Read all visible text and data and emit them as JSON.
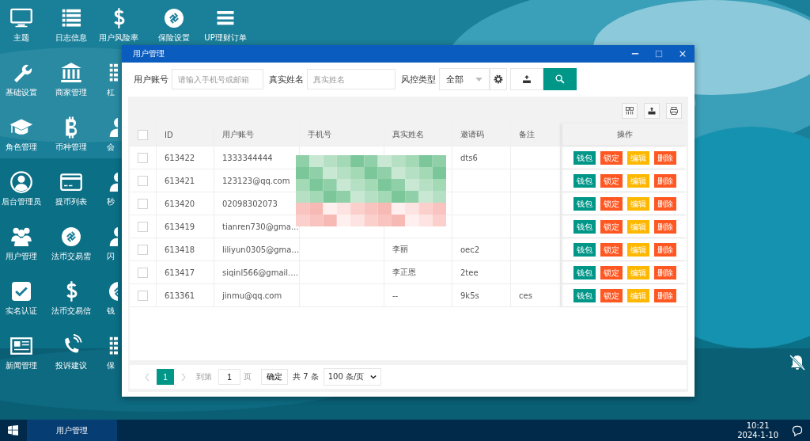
{
  "desktop_columns": [
    [
      {
        "kind": "monitor",
        "label": "主题"
      },
      {
        "kind": "wrench",
        "label": "基础设置"
      },
      {
        "kind": "grad",
        "label": "角色管理"
      },
      {
        "kind": "avatar",
        "label": "后台管理员"
      },
      {
        "kind": "users",
        "label": "用户管理"
      },
      {
        "kind": "check",
        "label": "实名认证"
      },
      {
        "kind": "news",
        "label": "新闻管理"
      }
    ],
    [
      {
        "kind": "list",
        "label": "日志信息"
      },
      {
        "kind": "bank",
        "label": "商家管理"
      },
      {
        "kind": "bitcoin",
        "label": "币种管理"
      },
      {
        "kind": "card",
        "label": "提币列表"
      },
      {
        "kind": "link",
        "label": "法币交易需"
      },
      {
        "kind": "dollar",
        "label": "法币交易信"
      },
      {
        "kind": "phone",
        "label": "投诉建议"
      }
    ],
    [
      {
        "kind": "dollar",
        "label": "用户风险率"
      },
      {
        "kind": "list",
        "label": "杠"
      },
      {
        "kind": "user",
        "label": "会"
      },
      {
        "kind": "user",
        "label": "秒"
      },
      {
        "kind": "user",
        "label": "闪"
      },
      {
        "kind": "link",
        "label": "钱"
      },
      {
        "kind": "list",
        "label": "保"
      }
    ],
    [
      {
        "kind": "link",
        "label": "保险设置"
      }
    ],
    [
      {
        "kind": "menu",
        "label": "UP理财订单"
      }
    ]
  ],
  "window": {
    "title": "用户管理",
    "filters": [
      {
        "kind": "input",
        "label": "用户账号",
        "placeholder": "请输入手机号或邮箱"
      },
      {
        "kind": "input",
        "label": "真实姓名",
        "placeholder": "真实姓名"
      },
      {
        "kind": "select",
        "label": "风控类型",
        "value": "全部"
      }
    ],
    "table": {
      "select_all_checked": false,
      "columns": [
        "ID",
        "用户账号",
        "手机号",
        "真实姓名",
        "邀请码",
        "备注",
        "操作"
      ],
      "rows": [
        {
          "checked": false,
          "id": "613422",
          "account": "1333344444",
          "invite_code": "dts6",
          "actions": [
            {
              "label": "钱包",
              "color": "#009688"
            },
            {
              "label": "锁定",
              "color": "#ff5722"
            },
            {
              "label": "编辑",
              "color": "#ffb800"
            },
            {
              "label": "删除",
              "color": "#ff5722"
            }
          ]
        },
        {
          "checked": false,
          "id": "613421",
          "account": "123123@qq.com",
          "actions": [
            {
              "label": "钱包",
              "color": "#009688"
            },
            {
              "label": "锁定",
              "color": "#ff5722"
            },
            {
              "label": "编辑",
              "color": "#ffb800"
            },
            {
              "label": "删除",
              "color": "#ff5722"
            }
          ]
        },
        {
          "checked": false,
          "id": "613420",
          "account": "02098302073",
          "actions": [
            {
              "label": "钱包",
              "color": "#009688"
            },
            {
              "label": "锁定",
              "color": "#ff5722"
            },
            {
              "label": "编辑",
              "color": "#ffb800"
            },
            {
              "label": "删除",
              "color": "#ff5722"
            }
          ]
        },
        {
          "checked": false,
          "id": "613419",
          "account": "tianren730@gma…",
          "actions": [
            {
              "label": "钱包",
              "color": "#009688"
            },
            {
              "label": "锁定",
              "color": "#ff5722"
            },
            {
              "label": "编辑",
              "color": "#ffb800"
            },
            {
              "label": "删除",
              "color": "#ff5722"
            }
          ]
        },
        {
          "checked": false,
          "id": "613418",
          "account": "liliyun0305@gma…",
          "real_name": "李丽",
          "invite_code": "oec2",
          "actions": [
            {
              "label": "钱包",
              "color": "#009688"
            },
            {
              "label": "锁定",
              "color": "#ff5722"
            },
            {
              "label": "编辑",
              "color": "#ffb800"
            },
            {
              "label": "删除",
              "color": "#ff5722"
            }
          ]
        },
        {
          "checked": false,
          "id": "613417",
          "account": "siqinl566@gmail.…",
          "real_name": "李正恩",
          "invite_code": "2tee",
          "actions": [
            {
              "label": "钱包",
              "color": "#009688"
            },
            {
              "label": "锁定",
              "color": "#ff5722"
            },
            {
              "label": "编辑",
              "color": "#ffb800"
            },
            {
              "label": "删除",
              "color": "#ff5722"
            }
          ]
        },
        {
          "checked": false,
          "id": "613361",
          "account": "jinmu@qq.com",
          "real_name": "--",
          "invite_code": "9k5s",
          "remark": "ces",
          "actions": [
            {
              "label": "钱包",
              "color": "#009688"
            },
            {
              "label": "锁定",
              "color": "#ff5722"
            },
            {
              "label": "编辑",
              "color": "#ffb800"
            },
            {
              "label": "删除",
              "color": "#ff5722"
            }
          ]
        }
      ]
    },
    "pagination": {
      "pages": [
        {
          "label": "1",
          "selected": true
        }
      ],
      "goto_label": "到第",
      "goto_value": "1",
      "page_unit": "页",
      "confirm": "确定",
      "total": "共 7 条",
      "page_size": "100 条/页"
    }
  },
  "taskbar": {
    "tasks": [
      {
        "label": "用户管理",
        "selected": true
      }
    ],
    "time": "10:21",
    "date": "2024-1-10"
  }
}
